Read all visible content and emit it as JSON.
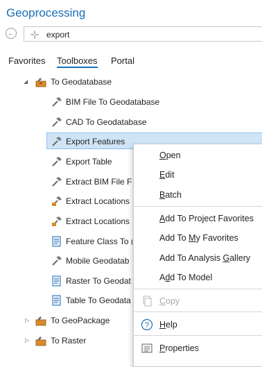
{
  "app": {
    "title": "Geoprocessing"
  },
  "search": {
    "value": "export"
  },
  "tabs": [
    {
      "label": "Favorites"
    },
    {
      "label": "Toolboxes",
      "active": true
    },
    {
      "label": "Portal"
    }
  ],
  "tree": {
    "toolbox": {
      "label": "To Geodatabase",
      "expanded": true
    },
    "tools": [
      {
        "label": "BIM File To Geodatabase",
        "icon": "hammer-icon"
      },
      {
        "label": "CAD To Geodatabase",
        "icon": "hammer-icon"
      },
      {
        "label": "Export Features",
        "icon": "hammer-icon",
        "selected": true
      },
      {
        "label": "Export Table",
        "icon": "hammer-icon"
      },
      {
        "label": "Extract BIM File F",
        "icon": "hammer-icon"
      },
      {
        "label": "Extract Locations",
        "icon": "model-tool-icon"
      },
      {
        "label": "Extract Locations",
        "icon": "model-tool-icon"
      },
      {
        "label": "Feature Class To (",
        "icon": "script-icon"
      },
      {
        "label": "Mobile Geodatab",
        "icon": "hammer-icon"
      },
      {
        "label": "Raster To Geodat",
        "icon": "script-icon"
      },
      {
        "label": "Table To Geodata",
        "icon": "script-icon"
      }
    ],
    "collapsed": [
      {
        "label": "To GeoPackage"
      },
      {
        "label": "To Raster"
      }
    ]
  },
  "context_menu": {
    "open": {
      "pre": "",
      "key": "O",
      "post": "pen"
    },
    "edit": {
      "pre": "",
      "key": "E",
      "post": "dit"
    },
    "batch": {
      "pre": "",
      "key": "B",
      "post": "atch"
    },
    "add_project_favorites": {
      "pre": "",
      "key": "A",
      "post": "dd To Project Favorites"
    },
    "add_my_favorites": {
      "pre": "Add To ",
      "key": "M",
      "post": "y Favorites"
    },
    "add_analysis_gallery": {
      "pre": "Add To Analysis ",
      "key": "G",
      "post": "allery"
    },
    "add_model": {
      "pre": "A",
      "key": "d",
      "post": "d To Model"
    },
    "copy": {
      "pre": "",
      "key": "C",
      "post": "opy",
      "disabled": true
    },
    "help": {
      "pre": "",
      "key": "H",
      "post": "elp"
    },
    "properties": {
      "pre": "",
      "key": "P",
      "post": "roperties"
    }
  },
  "colors": {
    "accent": "#1a6fb5",
    "selection": "#cfe5f7"
  }
}
